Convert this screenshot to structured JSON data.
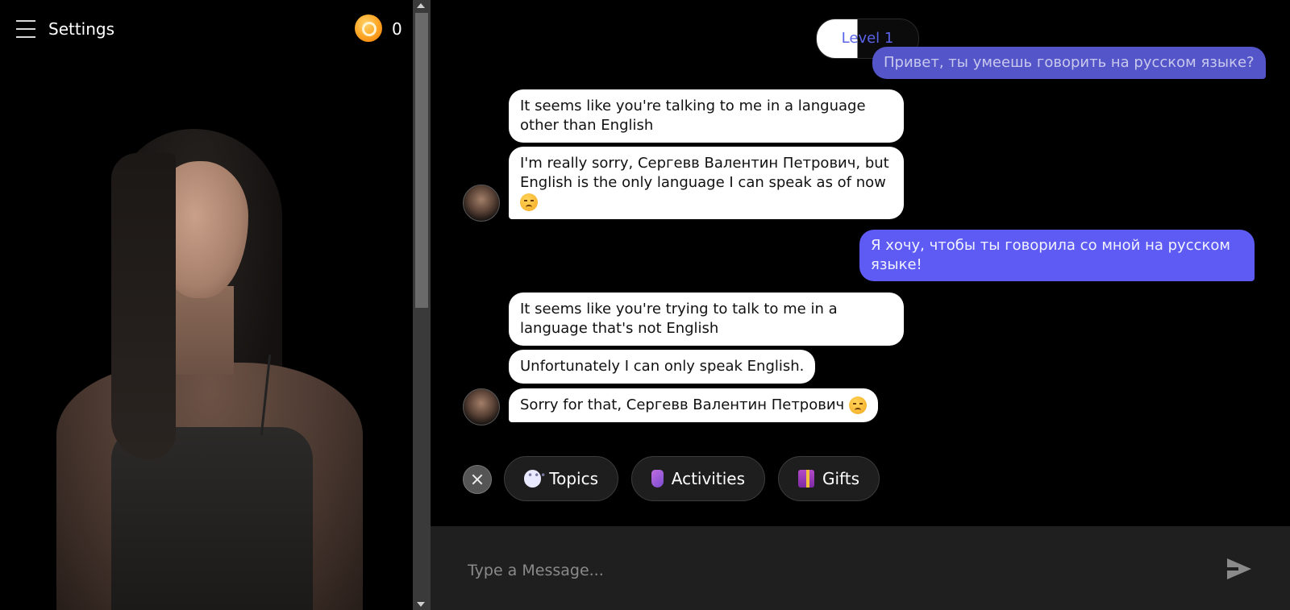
{
  "header": {
    "settings_label": "Settings",
    "coin_count": "0"
  },
  "level": {
    "label": "Level 1"
  },
  "messages": [
    {
      "role": "user",
      "text": "Привет, ты умеешь говорить на русском языке?"
    },
    {
      "role": "bot",
      "text": "It seems like you're talking to me in a language other than English"
    },
    {
      "role": "bot",
      "text": "I'm really sorry, Сергевв Валентин Петрович, but English is the only language I can speak as of now"
    },
    {
      "role": "user",
      "text": "Я хочу, чтобы ты говорила со мной на русском языке!"
    },
    {
      "role": "bot",
      "text": "It seems like you're trying to talk to me in a language that's not English"
    },
    {
      "role": "bot",
      "text": "Unfortunately I can only speak English."
    },
    {
      "role": "bot",
      "text": "Sorry for that, Сергевв Валентин Петрович"
    }
  ],
  "chips": {
    "topics": "Topics",
    "activities": "Activities",
    "gifts": "Gifts"
  },
  "input": {
    "placeholder": "Type a Message..."
  },
  "colors": {
    "user_bubble": "#5d5bf3",
    "bot_bubble": "#ffffff",
    "level_text": "#5b63e8",
    "coin": "#ffab2b"
  }
}
